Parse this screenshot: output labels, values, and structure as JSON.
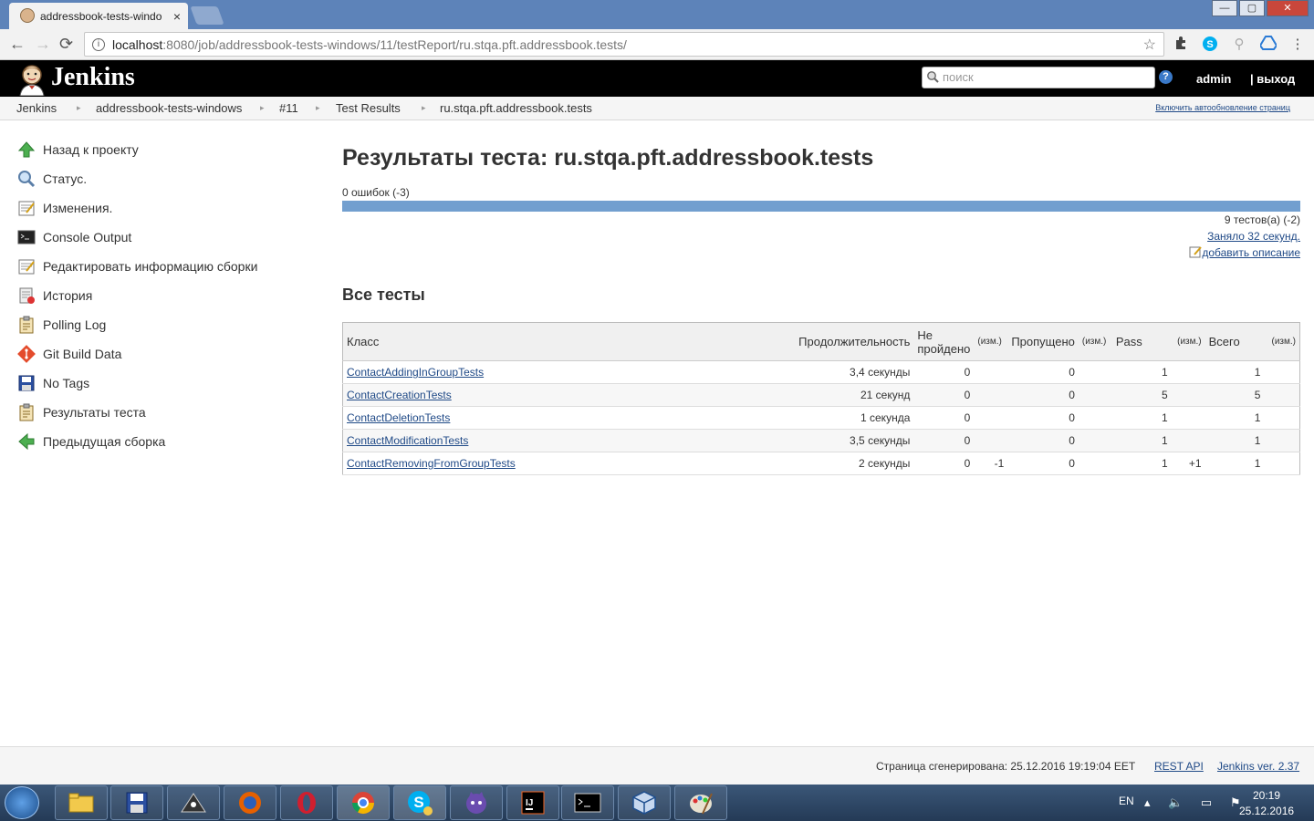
{
  "browser": {
    "tab_title": "addressbook-tests-windo",
    "tab_close": "×",
    "ghost_tab_title": "",
    "url_host": "localhost",
    "url_path": ":8080/job/addressbook-tests-windows/11/testReport/ru.stqa.pft.addressbook.tests/",
    "back": "←",
    "forward": "→",
    "reload": "⟳",
    "info": "i",
    "star": "☆",
    "window_buttons": [
      "—",
      "▢",
      "✕"
    ],
    "menu": "⋮"
  },
  "header": {
    "brand": "Jenkins",
    "search_placeholder": "поиск",
    "help": "?",
    "user": "admin",
    "logout": "| выход"
  },
  "breadcrumb": {
    "items": [
      "Jenkins",
      "addressbook-tests-windows",
      "#11",
      "Test Results",
      "ru.stqa.pft.addressbook.tests"
    ],
    "separator": "▸",
    "autorefresh": "Включить автообновление страниц"
  },
  "side_panel": {
    "items": [
      {
        "label": "Назад к проекту",
        "icon": "up-arrow-icon"
      },
      {
        "label": "Статус.",
        "icon": "search-icon"
      },
      {
        "label": "Изменения.",
        "icon": "notepad-icon"
      },
      {
        "label": "Console Output",
        "icon": "terminal-icon"
      },
      {
        "label": "Редактировать информацию сборки",
        "icon": "notepad-icon"
      },
      {
        "label": "История",
        "icon": "history-icon"
      },
      {
        "label": "Polling Log",
        "icon": "clipboard-icon"
      },
      {
        "label": "Git Build Data",
        "icon": "git-icon"
      },
      {
        "label": "No Tags",
        "icon": "save-icon"
      },
      {
        "label": "Результаты теста",
        "icon": "clipboard-icon"
      },
      {
        "label": "Предыдущая сборка",
        "icon": "left-arrow-icon"
      }
    ]
  },
  "main": {
    "title": "Результаты теста: ru.stqa.pft.addressbook.tests",
    "fail_summary": "0 ошибок (-3)",
    "progress_pass_fraction": 1.0,
    "test_count": "9 тестов(а) (-2)",
    "duration": "Заняло 32 секунд.",
    "add_description": "добавить описание",
    "section_title": "Все тесты",
    "table": {
      "headers": [
        "Класс",
        "Продолжительность",
        "Не пройдено",
        "(изм.)",
        "Пропущено",
        "(изм.)",
        "Pass",
        "(изм.)",
        "Всего",
        "(изм.)"
      ],
      "rows": [
        [
          "ContactAddingInGroupTests",
          "3,4 секунды",
          "0",
          "",
          "0",
          "",
          "1",
          "",
          "1",
          ""
        ],
        [
          "ContactCreationTests",
          "21 секунд",
          "0",
          "",
          "0",
          "",
          "5",
          "",
          "5",
          ""
        ],
        [
          "ContactDeletionTests",
          "1 секунда",
          "0",
          "",
          "0",
          "",
          "1",
          "",
          "1",
          ""
        ],
        [
          "ContactModificationTests",
          "3,5 секунды",
          "0",
          "",
          "0",
          "",
          "1",
          "",
          "1",
          ""
        ],
        [
          "ContactRemovingFromGroupTests",
          "2 секунды",
          "0",
          "-1",
          "0",
          "",
          "1",
          "+1",
          "1",
          ""
        ]
      ]
    }
  },
  "footer": {
    "generated": "Страница сгенерирована: 25.12.2016 19:19:04 EET",
    "rest_api": "REST API",
    "version": "Jenkins ver. 2.37"
  },
  "taskbar": {
    "lang": "EN",
    "time": "20:19",
    "date": "25.12.2016",
    "apps": [
      "file-explorer-icon",
      "save-icon",
      "eye-icon",
      "firefox-icon",
      "opera-icon",
      "chrome-icon",
      "skype-icon",
      "cat-icon",
      "intellij-icon",
      "terminal-icon",
      "virtualbox-icon",
      "paint-icon"
    ]
  },
  "colors": {
    "progress": "#729fcf",
    "link": "#204a87",
    "header_bg": "#000000",
    "tabstrip": "#5d83b9"
  }
}
